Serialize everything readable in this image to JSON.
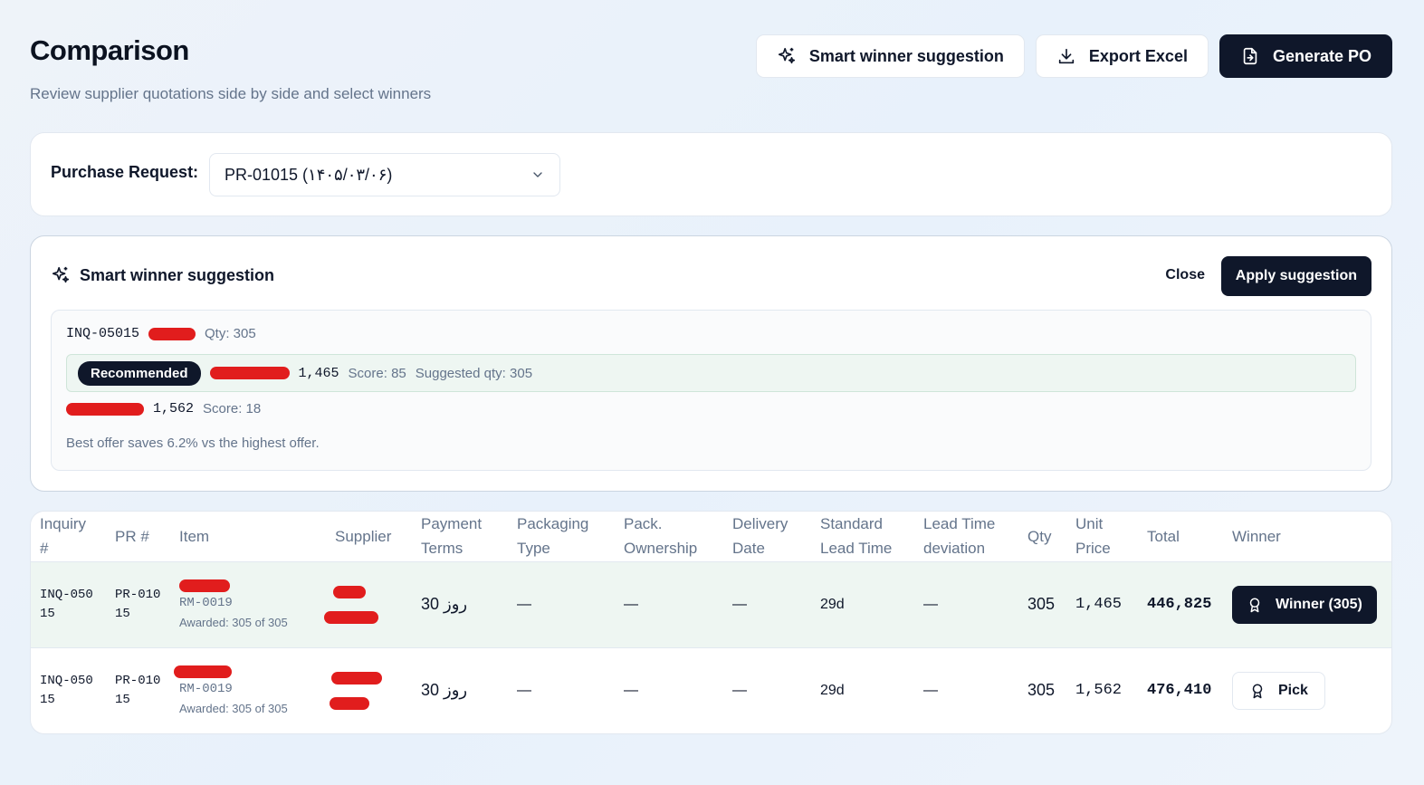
{
  "header": {
    "title": "Comparison",
    "subtitle": "Review supplier quotations side by side and select winners"
  },
  "toolbar": {
    "smart_label": "Smart winner suggestion",
    "export_label": "Export Excel",
    "generate_label": "Generate PO"
  },
  "purchase_request": {
    "label": "Purchase Request:",
    "selected": "PR-01015 (۱۴۰۵/۰۳/۰۶)"
  },
  "suggestion": {
    "title": "Smart winner suggestion",
    "close_label": "Close",
    "apply_label": "Apply suggestion",
    "inquiry": "INQ-05015",
    "qty": "Qty: 305",
    "recommended_badge": "Recommended",
    "recommended_price": "1,465",
    "recommended_score": "Score: 85",
    "recommended_suggested_qty": "Suggested qty: 305",
    "other_price": "1,562",
    "other_score": "Score: 18",
    "savings_note": "Best offer saves 6.2% vs the highest offer."
  },
  "table": {
    "headers": [
      "Inquiry #",
      "PR #",
      "Item",
      "Supplier",
      "Payment Terms",
      "Packaging Type",
      "Pack. Ownership",
      "Delivery Date",
      "Standard Lead Time",
      "Lead Time deviation",
      "Qty",
      "Unit Price",
      "Total",
      "Winner"
    ],
    "rows": [
      {
        "inquiry": "INQ-05015",
        "pr": "PR-01015",
        "item_code": "RM-0019",
        "awarded": "Awarded: 305 of 305",
        "payment_terms": "30 روز",
        "packaging_type": "—",
        "pack_ownership": "—",
        "delivery_date": "—",
        "standard_lead_time": "29d",
        "lead_time_deviation": "—",
        "qty": "305",
        "unit_price": "1,465",
        "total": "446,825",
        "winner_label": "Winner (305)"
      },
      {
        "inquiry": "INQ-05015",
        "pr": "PR-01015",
        "item_code": "RM-0019",
        "awarded": "Awarded: 305 of 305",
        "payment_terms": "30 روز",
        "packaging_type": "—",
        "pack_ownership": "—",
        "delivery_date": "—",
        "standard_lead_time": "29d",
        "lead_time_deviation": "—",
        "qty": "305",
        "unit_price": "1,562",
        "total": "476,410",
        "winner_label": "Pick"
      }
    ]
  },
  "colors": {
    "primary": "#0f172a",
    "highlight_row": "#eef6f2",
    "muted_text": "#64748b",
    "redaction": "#e11d1d"
  }
}
